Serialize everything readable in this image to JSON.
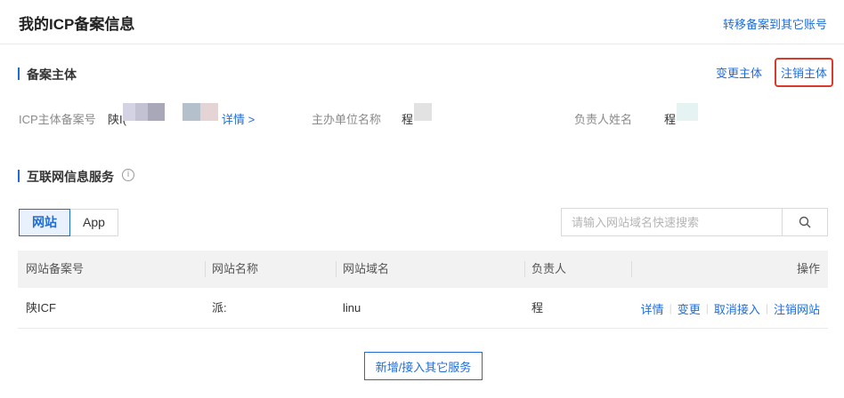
{
  "header": {
    "title": "我的ICP备案信息",
    "transfer_link": "转移备案到其它账号"
  },
  "subject": {
    "section_title": "备案主体",
    "change_label": "变更主体",
    "cancel_label": "注销主体",
    "icp_label": "ICP主体备案号",
    "icp_value": "陕I(",
    "detail_link": "详情 >",
    "org_label": "主办单位名称",
    "org_value": "程",
    "owner_label": "负责人姓名",
    "owner_value": "程"
  },
  "services": {
    "section_title": "互联网信息服务",
    "info_icon": "info-circle-icon",
    "tabs": [
      {
        "label": "网站",
        "active": true
      },
      {
        "label": "App",
        "active": false
      }
    ],
    "search_placeholder": "请输入网站域名快速搜索",
    "search_icon": "magnifier-icon",
    "table": {
      "headers": [
        "网站备案号",
        "网站名称",
        "网站域名",
        "负责人",
        "操作"
      ],
      "rows": [
        {
          "record_no": "陕ICF",
          "site_name": "派:",
          "domain": "linu",
          "owner": "程",
          "actions": [
            "详情",
            "变更",
            "取消接入",
            "注销网站"
          ]
        }
      ]
    },
    "add_button": "新增/接入其它服务"
  },
  "colors": {
    "accent": "#1f6cd6",
    "highlight_border": "#d93a2b",
    "header_bg": "#f2f2f2"
  }
}
